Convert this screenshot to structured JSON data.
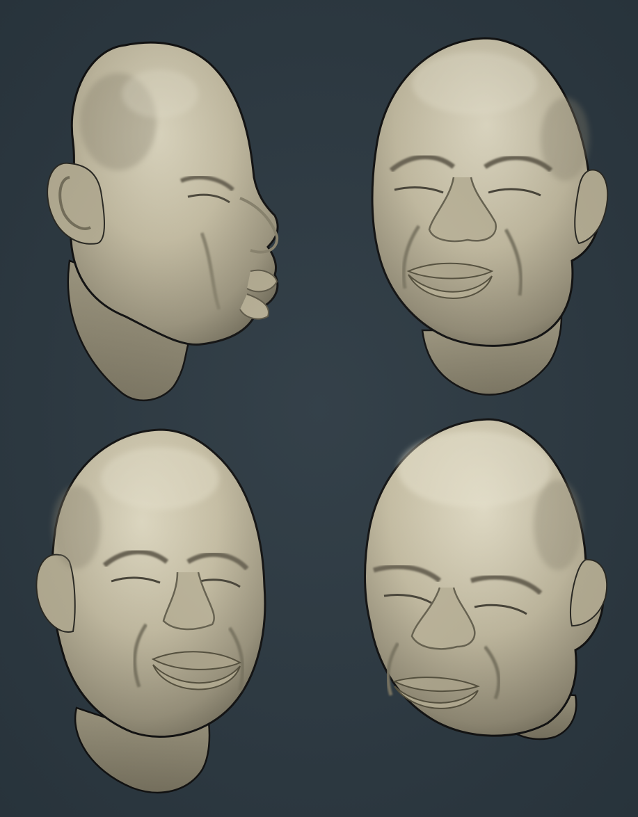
{
  "scene": {
    "background_color": "#2d3a43",
    "material_color": "#c9c1a6",
    "views": [
      {
        "name": "head-profile-right"
      },
      {
        "name": "head-three-quarter-left"
      },
      {
        "name": "head-front"
      },
      {
        "name": "head-three-quarter-low"
      }
    ]
  }
}
